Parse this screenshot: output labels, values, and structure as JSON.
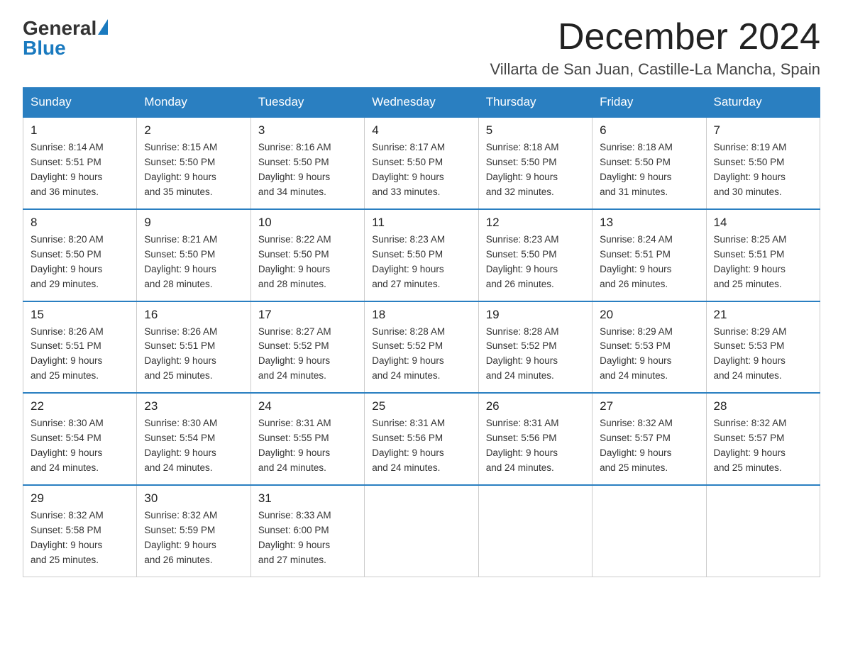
{
  "header": {
    "logo_general": "General",
    "logo_blue": "Blue",
    "title": "December 2024",
    "subtitle": "Villarta de San Juan, Castille-La Mancha, Spain"
  },
  "weekdays": [
    "Sunday",
    "Monday",
    "Tuesday",
    "Wednesday",
    "Thursday",
    "Friday",
    "Saturday"
  ],
  "weeks": [
    [
      {
        "day": "1",
        "sunrise": "8:14 AM",
        "sunset": "5:51 PM",
        "daylight": "9 hours and 36 minutes."
      },
      {
        "day": "2",
        "sunrise": "8:15 AM",
        "sunset": "5:50 PM",
        "daylight": "9 hours and 35 minutes."
      },
      {
        "day": "3",
        "sunrise": "8:16 AM",
        "sunset": "5:50 PM",
        "daylight": "9 hours and 34 minutes."
      },
      {
        "day": "4",
        "sunrise": "8:17 AM",
        "sunset": "5:50 PM",
        "daylight": "9 hours and 33 minutes."
      },
      {
        "day": "5",
        "sunrise": "8:18 AM",
        "sunset": "5:50 PM",
        "daylight": "9 hours and 32 minutes."
      },
      {
        "day": "6",
        "sunrise": "8:18 AM",
        "sunset": "5:50 PM",
        "daylight": "9 hours and 31 minutes."
      },
      {
        "day": "7",
        "sunrise": "8:19 AM",
        "sunset": "5:50 PM",
        "daylight": "9 hours and 30 minutes."
      }
    ],
    [
      {
        "day": "8",
        "sunrise": "8:20 AM",
        "sunset": "5:50 PM",
        "daylight": "9 hours and 29 minutes."
      },
      {
        "day": "9",
        "sunrise": "8:21 AM",
        "sunset": "5:50 PM",
        "daylight": "9 hours and 28 minutes."
      },
      {
        "day": "10",
        "sunrise": "8:22 AM",
        "sunset": "5:50 PM",
        "daylight": "9 hours and 28 minutes."
      },
      {
        "day": "11",
        "sunrise": "8:23 AM",
        "sunset": "5:50 PM",
        "daylight": "9 hours and 27 minutes."
      },
      {
        "day": "12",
        "sunrise": "8:23 AM",
        "sunset": "5:50 PM",
        "daylight": "9 hours and 26 minutes."
      },
      {
        "day": "13",
        "sunrise": "8:24 AM",
        "sunset": "5:51 PM",
        "daylight": "9 hours and 26 minutes."
      },
      {
        "day": "14",
        "sunrise": "8:25 AM",
        "sunset": "5:51 PM",
        "daylight": "9 hours and 25 minutes."
      }
    ],
    [
      {
        "day": "15",
        "sunrise": "8:26 AM",
        "sunset": "5:51 PM",
        "daylight": "9 hours and 25 minutes."
      },
      {
        "day": "16",
        "sunrise": "8:26 AM",
        "sunset": "5:51 PM",
        "daylight": "9 hours and 25 minutes."
      },
      {
        "day": "17",
        "sunrise": "8:27 AM",
        "sunset": "5:52 PM",
        "daylight": "9 hours and 24 minutes."
      },
      {
        "day": "18",
        "sunrise": "8:28 AM",
        "sunset": "5:52 PM",
        "daylight": "9 hours and 24 minutes."
      },
      {
        "day": "19",
        "sunrise": "8:28 AM",
        "sunset": "5:52 PM",
        "daylight": "9 hours and 24 minutes."
      },
      {
        "day": "20",
        "sunrise": "8:29 AM",
        "sunset": "5:53 PM",
        "daylight": "9 hours and 24 minutes."
      },
      {
        "day": "21",
        "sunrise": "8:29 AM",
        "sunset": "5:53 PM",
        "daylight": "9 hours and 24 minutes."
      }
    ],
    [
      {
        "day": "22",
        "sunrise": "8:30 AM",
        "sunset": "5:54 PM",
        "daylight": "9 hours and 24 minutes."
      },
      {
        "day": "23",
        "sunrise": "8:30 AM",
        "sunset": "5:54 PM",
        "daylight": "9 hours and 24 minutes."
      },
      {
        "day": "24",
        "sunrise": "8:31 AM",
        "sunset": "5:55 PM",
        "daylight": "9 hours and 24 minutes."
      },
      {
        "day": "25",
        "sunrise": "8:31 AM",
        "sunset": "5:56 PM",
        "daylight": "9 hours and 24 minutes."
      },
      {
        "day": "26",
        "sunrise": "8:31 AM",
        "sunset": "5:56 PM",
        "daylight": "9 hours and 24 minutes."
      },
      {
        "day": "27",
        "sunrise": "8:32 AM",
        "sunset": "5:57 PM",
        "daylight": "9 hours and 25 minutes."
      },
      {
        "day": "28",
        "sunrise": "8:32 AM",
        "sunset": "5:57 PM",
        "daylight": "9 hours and 25 minutes."
      }
    ],
    [
      {
        "day": "29",
        "sunrise": "8:32 AM",
        "sunset": "5:58 PM",
        "daylight": "9 hours and 25 minutes."
      },
      {
        "day": "30",
        "sunrise": "8:32 AM",
        "sunset": "5:59 PM",
        "daylight": "9 hours and 26 minutes."
      },
      {
        "day": "31",
        "sunrise": "8:33 AM",
        "sunset": "6:00 PM",
        "daylight": "9 hours and 27 minutes."
      },
      null,
      null,
      null,
      null
    ]
  ],
  "labels": {
    "sunrise": "Sunrise:",
    "sunset": "Sunset:",
    "daylight": "Daylight:"
  }
}
